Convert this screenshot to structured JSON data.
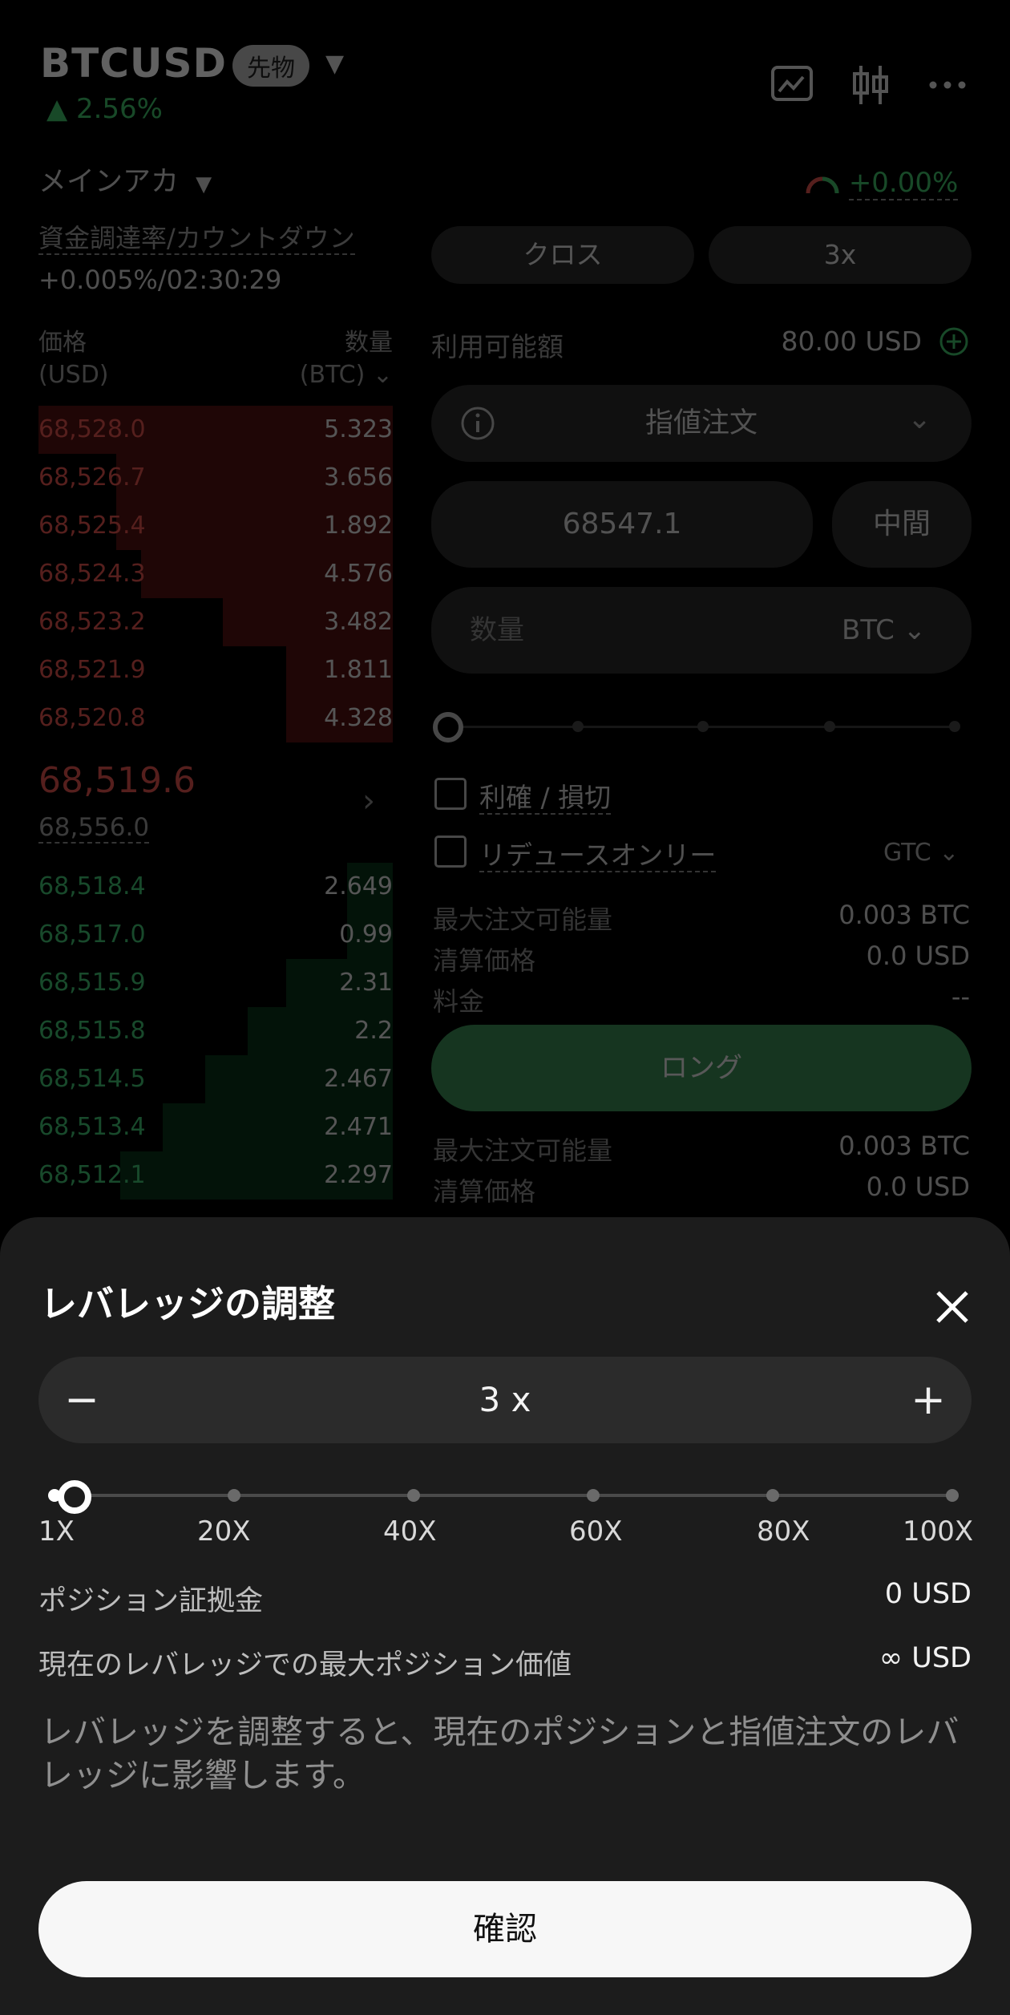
{
  "header": {
    "symbol": "BTCUSD",
    "badge": "先物",
    "change": "▲ 2.56%",
    "account": "メインアカ",
    "funding_label": "資金調達率/カウントダウン",
    "funding_value": "+0.005%/02:30:29",
    "gauge_value": "+0.00%"
  },
  "orderbook": {
    "price_header": "価格",
    "price_unit": "(USD)",
    "qty_header": "数量",
    "qty_unit": "(BTC)",
    "asks": [
      {
        "price": "68,528.0",
        "qty": "5.323",
        "depth": 1.0
      },
      {
        "price": "68,526.7",
        "qty": "3.656",
        "depth": 0.78
      },
      {
        "price": "68,525.4",
        "qty": "1.892",
        "depth": 0.78
      },
      {
        "price": "68,524.3",
        "qty": "4.576",
        "depth": 0.71
      },
      {
        "price": "68,523.2",
        "qty": "3.482",
        "depth": 0.48
      },
      {
        "price": "68,521.9",
        "qty": "1.811",
        "depth": 0.3
      },
      {
        "price": "68,520.8",
        "qty": "4.328",
        "depth": 0.3
      }
    ],
    "mid_price": "68,519.6",
    "mark_price": "68,556.0",
    "bids": [
      {
        "price": "68,518.4",
        "qty": "2.649",
        "depth": 0.13
      },
      {
        "price": "68,517.0",
        "qty": "0.99",
        "depth": 0.13
      },
      {
        "price": "68,515.9",
        "qty": "2.31",
        "depth": 0.3
      },
      {
        "price": "68,515.8",
        "qty": "2.2",
        "depth": 0.41
      },
      {
        "price": "68,514.5",
        "qty": "2.467",
        "depth": 0.53
      },
      {
        "price": "68,513.4",
        "qty": "2.471",
        "depth": 0.65
      },
      {
        "price": "68,512.1",
        "qty": "2.297",
        "depth": 0.77
      }
    ]
  },
  "order_form": {
    "margin_mode": "クロス",
    "leverage": "3x",
    "available_label": "利用可能額",
    "available_value": "80.00 USD",
    "order_type": "指値注文",
    "price_value": "68547.1",
    "mid_button": "中間",
    "qty_placeholder": "数量",
    "qty_unit": "BTC",
    "tpsl_label": "利確 / 損切",
    "reduce_only_label": "リデュースオンリー",
    "tif": "GTC",
    "info_rows": [
      {
        "label": "最大注文可能量",
        "value": "0.003 BTC"
      },
      {
        "label": "清算価格",
        "value": "0.0 USD"
      },
      {
        "label": "料金",
        "value": "--"
      }
    ],
    "long_button": "ロング",
    "info_rows_2": [
      {
        "label": "最大注文可能量",
        "value": "0.003 BTC"
      },
      {
        "label": "清算価格",
        "value": "0.0 USD"
      }
    ]
  },
  "sheet": {
    "title": "レバレッジの調整",
    "leverage_value": "3 x",
    "minus": "−",
    "plus": "+",
    "slider_level": 0.02,
    "ticks": [
      "1X",
      "20X",
      "40X",
      "60X",
      "80X",
      "100X"
    ],
    "margin_label": "ポジション証拠金",
    "margin_value": "0 USD",
    "max_pos_label": "現在のレバレッジでの最大ポジション価値",
    "max_pos_value": "∞ USD",
    "note": "レバレッジを調整すると、現在のポジションと指値注文のレバレッジに影響します。",
    "confirm": "確認"
  },
  "colors": {
    "ask": "#e0524d",
    "bid": "#3fbf72",
    "long": "#3b8c55"
  }
}
